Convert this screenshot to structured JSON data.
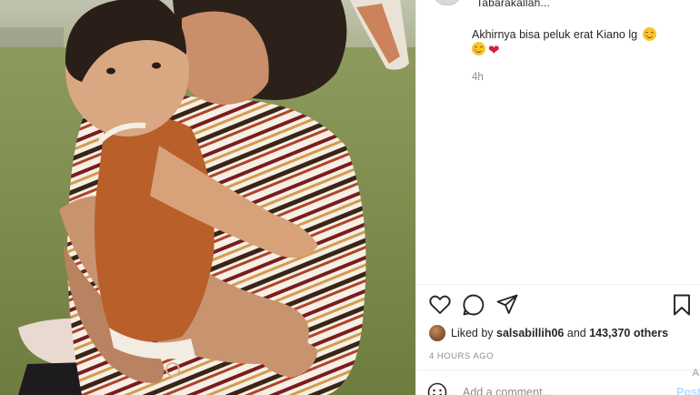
{
  "post": {
    "caption_truncated": "Tabarakallah...",
    "caption_text": "Akhirnya bisa peluk erat Kiano lg",
    "caption_time": "4h",
    "liked_by_prefix": "Liked by ",
    "liked_by_user": "salsabillih06",
    "liked_by_middle": " and ",
    "liked_by_count": "143,370 others",
    "timestamp": "4 HOURS AGO",
    "comment_placeholder": "Add a comment...",
    "post_button": "Post",
    "scroll_letter": "A"
  },
  "colors": {
    "post_button": "#b3dbff",
    "heart_emoji": "#d71f36",
    "muted_text": "#8e8e8e"
  },
  "icons": {
    "like": "heart-outline-icon",
    "comment": "speech-bubble-icon",
    "share": "paper-plane-icon",
    "save": "bookmark-icon",
    "emoji": "smiley-face-icon"
  }
}
